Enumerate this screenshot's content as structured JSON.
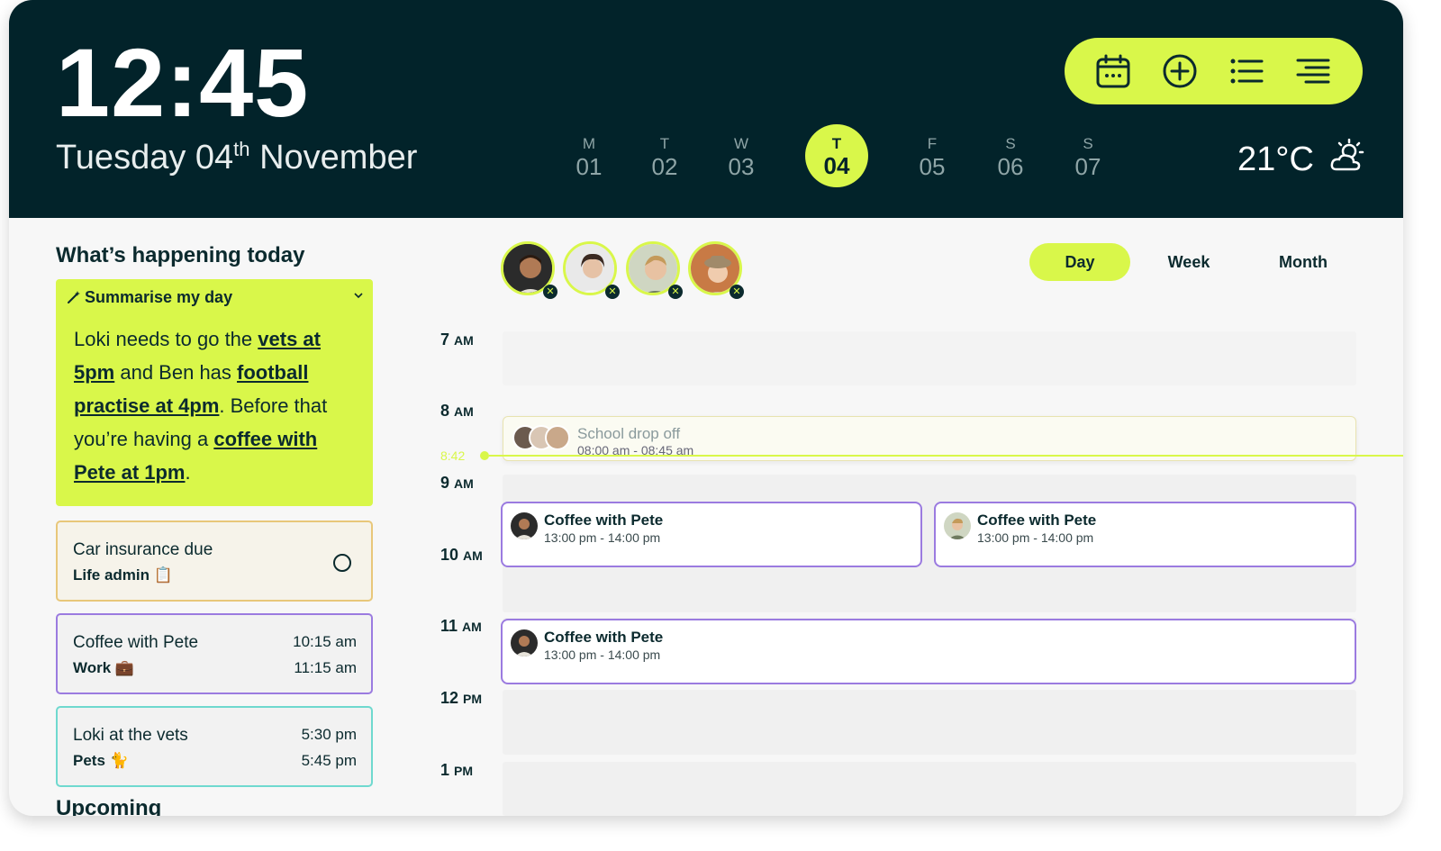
{
  "header": {
    "time": "12:45",
    "date_prefix": "Tuesday 04",
    "date_suffix": "th",
    "date_rest": " November",
    "temperature": "21°C",
    "weather_icon": "partly-sunny-icon",
    "toolbar_icons": [
      "calendar-icon",
      "add-circle-icon",
      "list-icon",
      "align-right-icon"
    ],
    "days": [
      {
        "letter": "M",
        "num": "01"
      },
      {
        "letter": "T",
        "num": "02"
      },
      {
        "letter": "W",
        "num": "03"
      },
      {
        "letter": "T",
        "num": "04"
      },
      {
        "letter": "F",
        "num": "05"
      },
      {
        "letter": "S",
        "num": "06"
      },
      {
        "letter": "S",
        "num": "07"
      }
    ]
  },
  "sidebar": {
    "title": "What’s happening today",
    "summary": {
      "heading": "Summarise my day",
      "t1": "Loki needs to go the ",
      "b1": "vets at 5pm",
      "t2": " and Ben has ",
      "b2": "football practise at 4pm",
      "t3": ". Before that you’re having a ",
      "b3": "coffee with Pete at 1pm",
      "t4": "."
    },
    "cards": [
      {
        "title": "Car insurance due",
        "category": "Life admin 📋",
        "border": "#e8c77a"
      },
      {
        "title": "Coffee with Pete",
        "category": "Work 💼",
        "start": "10:15 am",
        "end": "11:15 am",
        "border": "#9b7be0"
      },
      {
        "title": "Loki at the vets",
        "category": "Pets 🐈",
        "start": "5:30 pm",
        "end": "5:45 pm",
        "border": "#6fd9cf"
      }
    ],
    "upcoming": "Upcoming"
  },
  "calendar": {
    "views": [
      "Day",
      "Week",
      "Month"
    ],
    "active_view": "Day",
    "hours": [
      {
        "num": "7",
        "ampm": "AM"
      },
      {
        "num": "8",
        "ampm": "AM"
      },
      {
        "num": "9",
        "ampm": "AM"
      },
      {
        "num": "10",
        "ampm": "AM"
      },
      {
        "num": "11",
        "ampm": "AM"
      },
      {
        "num": "12",
        "ampm": "PM"
      },
      {
        "num": "1",
        "ampm": "PM"
      }
    ],
    "now": "8:42",
    "drop_off": {
      "title": "School drop off",
      "start": "08:00 am",
      "end": "08:45 am"
    },
    "events": [
      {
        "title": "Coffee with Pete",
        "start": "13:00 pm",
        "end": "14:00 pm"
      },
      {
        "title": "Coffee with Pete",
        "start": "13:00 pm",
        "end": "14:00 pm"
      },
      {
        "title": "Coffee with Pete",
        "start": "13:00 pm",
        "end": "14:00 pm"
      }
    ],
    "colors": {
      "accent": "#d9f74a",
      "header": "#02232a",
      "event_border": "#9b7be0"
    }
  }
}
